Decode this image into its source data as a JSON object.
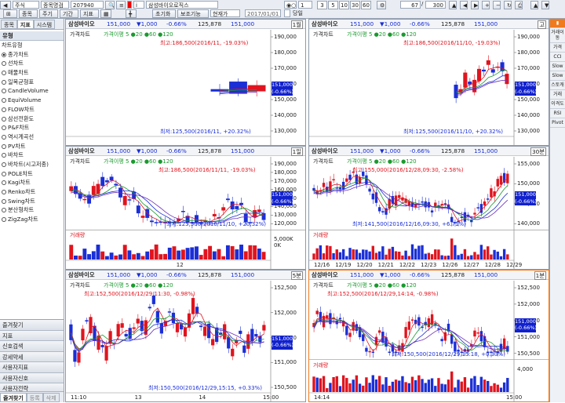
{
  "toolbar": {
    "stock_name": "삼성바이오로직스",
    "search_hint": "종목명검",
    "code": "207940",
    "menu_stock": "종목",
    "menu_cycle": "주기",
    "menu_period": "기간",
    "menu_indicator": "지표",
    "btn_init": "초기화",
    "btn_aux": "보조기능",
    "current": "현재가",
    "date": "2017/01/01",
    "day_label": "당일",
    "periods": [
      "1",
      "3",
      "5",
      "10",
      "30",
      "60"
    ],
    "count1": "67",
    "count2": "300",
    "row1_a": "종목",
    "row1_b": "주식"
  },
  "left_panel": {
    "tabs": [
      "종목",
      "지표",
      "시스템"
    ],
    "section": "유형",
    "group": "차트유형",
    "items": [
      "종가차트",
      "선차트",
      "매물차트",
      "일목균형표",
      "CandleVolume",
      "EquiVolume",
      "FLOW차트",
      "삼선전환도",
      "P&F차트",
      "역시계곡선",
      "PV차트",
      "바차트",
      "바차트(시고저종)",
      "POLE차트",
      "Kagi차트",
      "Renko차트",
      "Swing차트",
      "분산형차트",
      "ZigZag차트"
    ],
    "bottom": [
      "즐겨찾기",
      "지표",
      "신호검색",
      "강세약세",
      "사용자지표",
      "사용자신호",
      "사용자전략"
    ],
    "footer_tabs": [
      "즐겨찾기",
      "등록",
      "삭제"
    ]
  },
  "panels": [
    {
      "header": {
        "name": "삼성바이오",
        "price": "151,000",
        "chg": "▼1,000",
        "pct": "-0.66%",
        "vol": "125,878",
        "last": "151,000",
        "cycle": "1월"
      },
      "legend": "가격차트",
      "ma": "가격이평 5 ●20 ●60 ●120",
      "high": "최고:186,500(2016/11, -19.03%)",
      "low": "최저:125,500(2016/11, +20.32%)",
      "price_box": [
        "151,000",
        "(-0.66%)"
      ],
      "yticks": [
        "190,000",
        "180,000",
        "170,000",
        "160,000",
        "150,000",
        "140,000",
        "130,000"
      ]
    },
    {
      "header": {
        "name": "삼성바이오",
        "price": "151,000",
        "chg": "▼1,000",
        "pct": "-0.66%",
        "vol": "125,878",
        "last": "151,000",
        "cycle": "고"
      },
      "legend": "가격차트",
      "ma": "가격이평 5 ●20 ●60 ●120",
      "high": "최고:186,500(2016/11/10, -19.03%)",
      "low": "최저:125,500(2016/11/10, +20.32%)",
      "price_box": [
        "151,000",
        "(-0.66%)"
      ],
      "yticks": [
        "190,000",
        "180,000",
        "170,000",
        "160,000",
        "150,000",
        "140,000",
        "130,000"
      ]
    },
    {
      "header": {
        "name": "삼성바이오",
        "price": "151,000",
        "chg": "▼1,000",
        "pct": "-0.66%",
        "vol": "125,878",
        "last": "151,000",
        "cycle": "1일"
      },
      "legend": "가격차트",
      "ma": "가격이평 5 ●20 ●60 ●120",
      "high": "최고:186,500(2016/11/11, -19.03%)",
      "low": "최저:125,500(2016/11/10, +20.32%)",
      "price_box": [
        "151,000",
        "(-0.66%)"
      ],
      "yticks": [
        "190,000",
        "180,000",
        "170,000",
        "160,000",
        "150,000",
        "140,000",
        "130,000",
        "120,000"
      ],
      "volume_label": "거래량",
      "vol_ticks": [
        "5,000K",
        "0K"
      ],
      "xlabels": [
        "12"
      ]
    },
    {
      "header": {
        "name": "삼성바이오",
        "price": "151,000",
        "chg": "▼1,000",
        "pct": "-0.66%",
        "vol": "125,878",
        "last": "151,000",
        "cycle": "30분"
      },
      "legend": "가격차트",
      "ma": "가격이평 5 ●20 ●60 ●120",
      "high": "최고:155,000(2016/12/28,09:30, -2.58%)",
      "low": "최저:141,500(2016/12/16,09:30, +6.71%)",
      "price_box": [
        "151,000",
        "(-0.66%)"
      ],
      "yticks": [
        "155,000",
        "150,000",
        "145,000",
        "140,000"
      ],
      "volume_label": "거래량",
      "xlabels": [
        "12/16",
        "12/19",
        "12/20",
        "12/21",
        "12/22",
        "12/23",
        "12/26",
        "12/27",
        "12/28",
        "12/29"
      ]
    },
    {
      "header": {
        "name": "삼성바이오",
        "price": "151,000",
        "chg": "▼1,000",
        "pct": "-0.66%",
        "vol": "125,878",
        "last": "151,000",
        "cycle": "5분"
      },
      "legend": "가격차트",
      "ma": "가격이평 5 ●20 ●60 ●120",
      "high": "최고:152,500(2016/12/29,11:30, -0.98%)",
      "low": "최저:150,500(2016/12/29,15:15, +0.33%)",
      "price_box": [
        "151,000",
        "(-0.66%)"
      ],
      "yticks": [
        "152,500",
        "152,000",
        "151,500",
        "151,000",
        "150,500"
      ],
      "xlabels": [
        "11:10",
        "13",
        "14",
        "15:00"
      ]
    },
    {
      "header": {
        "name": "삼성바이오",
        "price": "151,000",
        "chg": "▼1,000",
        "pct": "-0.66%",
        "vol": "125,878",
        "last": "151,000",
        "cycle": "1분"
      },
      "legend": "가격차트",
      "ma": "가격이평 5 ●20 ●60 ●120",
      "high": "최고:152,500(2016/12/29,14:14, -0.98%)",
      "low": "최저:150,500(2016/12/29,15:18, +0.33%)",
      "price_box": [
        "151,000",
        "(-0.66%)"
      ],
      "yticks": [
        "152,500",
        "152,000",
        "151,500",
        "151,000",
        "150,500"
      ],
      "volume_label": "거래량",
      "vol_ticks": [
        "4,000"
      ],
      "xlabels": [
        "14:14",
        "15:00"
      ]
    }
  ],
  "right_strip": [
    "거래이동",
    "가격",
    "CCI",
    "Slow",
    "Slow",
    "스토캐",
    "거래",
    "이격도",
    "RSI",
    "Pivot"
  ],
  "colors": {
    "up": "#e0141e",
    "down": "#1a2fd6",
    "ma5": "#e0141e",
    "ma20": "#1a9a2e",
    "ma60": "#1a2fd6",
    "ma120": "#6b2db8",
    "price_box": "#1121cc",
    "active": "#f07a1e"
  }
}
